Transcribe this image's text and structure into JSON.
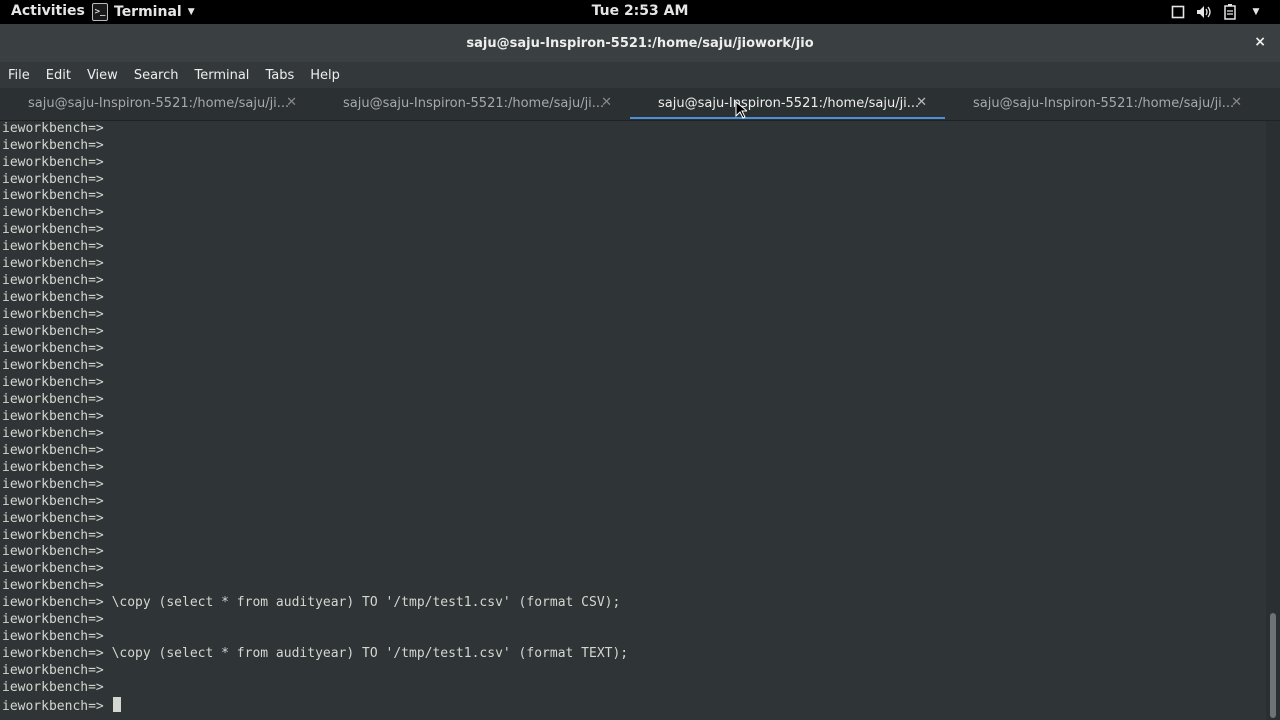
{
  "topbar": {
    "activities": "Activities",
    "app_menu": "Terminal",
    "clock": "Tue  2:53 AM",
    "tray_icons": [
      "window-icon",
      "volume-icon",
      "battery-icon",
      "chevron-down-icon"
    ]
  },
  "window": {
    "title": "saju@saju-Inspiron-5521:/home/saju/jiowork/jio",
    "close_glyph": "×"
  },
  "menubar": {
    "items": [
      "File",
      "Edit",
      "View",
      "Search",
      "Terminal",
      "Tabs",
      "Help"
    ]
  },
  "tabs": [
    {
      "label": "saju@saju-Inspiron-5521:/home/saju/ji...",
      "active": false
    },
    {
      "label": "saju@saju-Inspiron-5521:/home/saju/ji...",
      "active": false
    },
    {
      "label": "saju@saju-Inspiron-5521:/home/saju/ji...",
      "active": true
    },
    {
      "label": "saju@saju-Inspiron-5521:/home/saju/ji...",
      "active": false
    }
  ],
  "terminal": {
    "prompt": "ieworkbench=>",
    "lines": [
      "ieworkbench=>",
      "ieworkbench=>",
      "ieworkbench=>",
      "ieworkbench=>",
      "ieworkbench=>",
      "ieworkbench=>",
      "ieworkbench=>",
      "ieworkbench=>",
      "ieworkbench=>",
      "ieworkbench=>",
      "ieworkbench=>",
      "ieworkbench=>",
      "ieworkbench=>",
      "ieworkbench=>",
      "ieworkbench=>",
      "ieworkbench=>",
      "ieworkbench=>",
      "ieworkbench=>",
      "ieworkbench=>",
      "ieworkbench=>",
      "ieworkbench=>",
      "ieworkbench=>",
      "ieworkbench=>",
      "ieworkbench=>",
      "ieworkbench=>",
      "ieworkbench=>",
      "ieworkbench=>",
      "ieworkbench=>",
      "ieworkbench=> \\copy (select * from audityear) TO '/tmp/test1.csv' (format CSV);",
      "ieworkbench=>",
      "ieworkbench=>",
      "ieworkbench=> \\copy (select * from audityear) TO '/tmp/test1.csv' (format TEXT);",
      "ieworkbench=>",
      "ieworkbench=>"
    ],
    "current_input": ""
  }
}
